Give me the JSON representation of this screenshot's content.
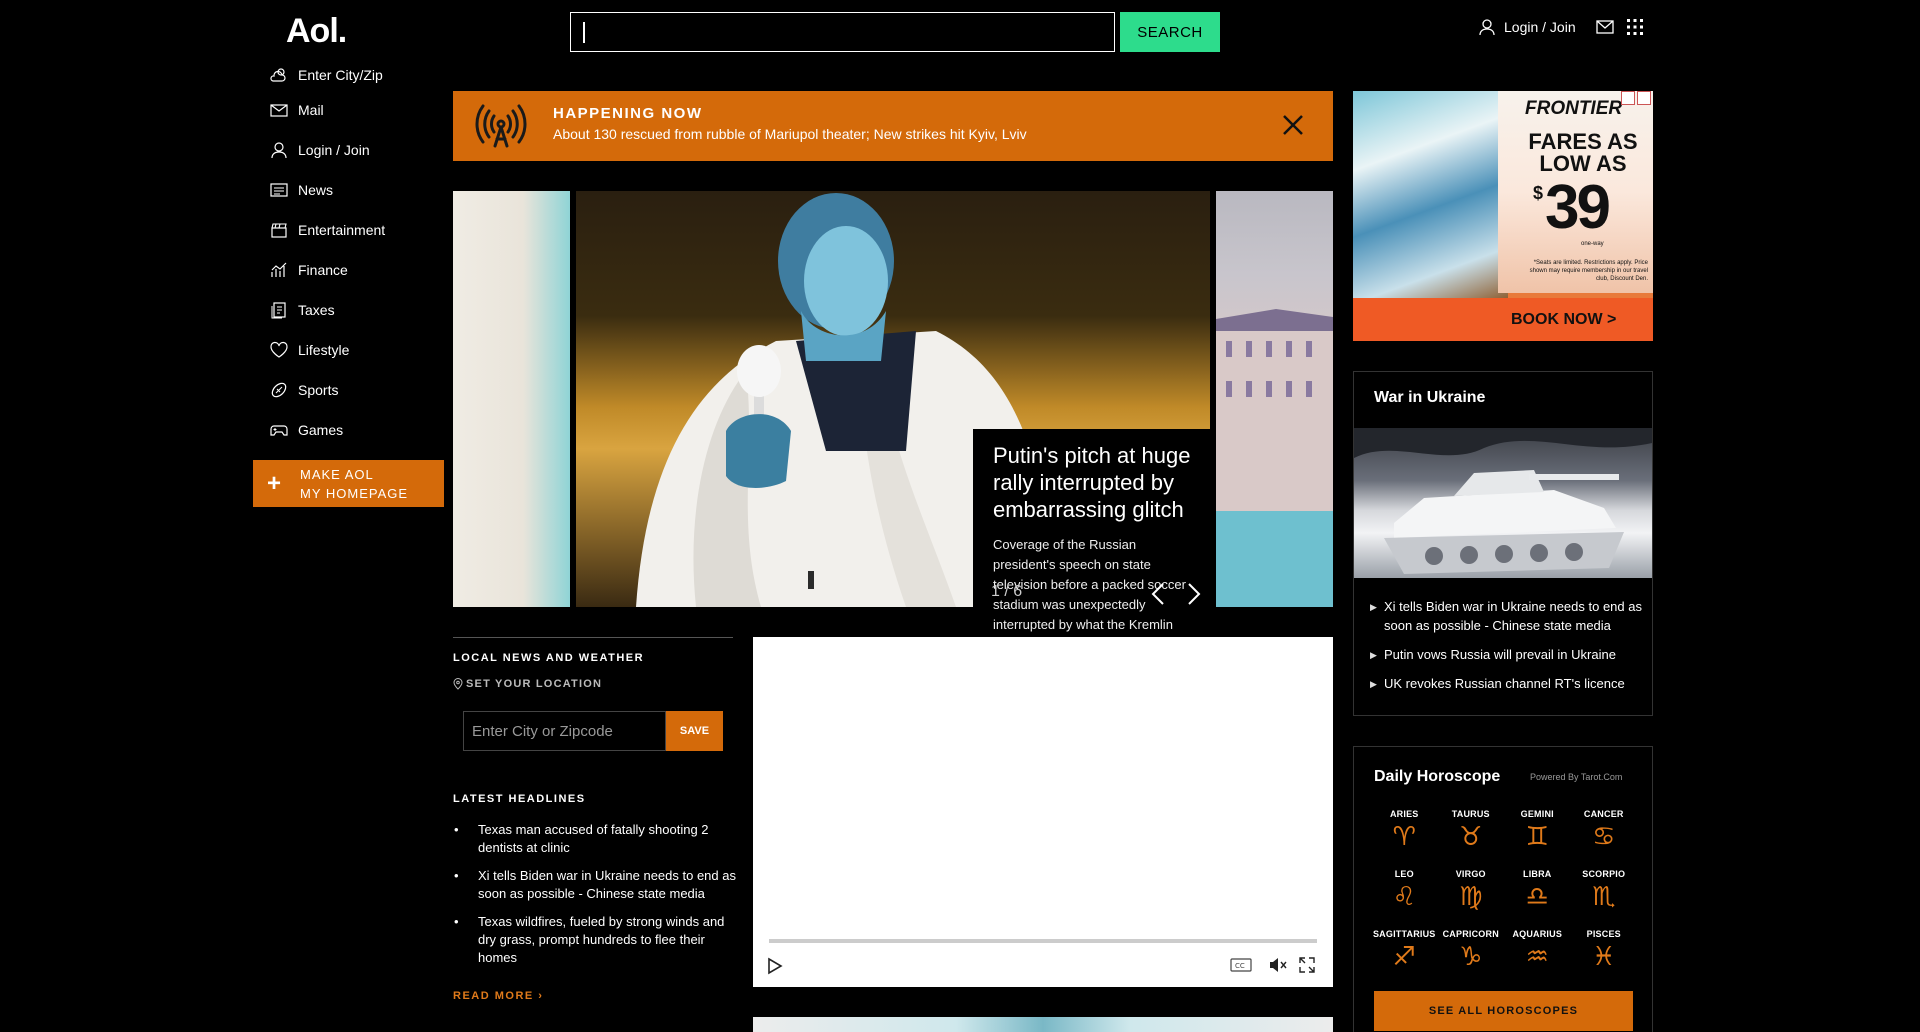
{
  "header": {
    "logo": "Aol.",
    "search_button": "SEARCH",
    "login": "Login / Join"
  },
  "sidebar": {
    "items": [
      {
        "label": "Enter City/Zip",
        "icon": "weather-icon"
      },
      {
        "label": "Mail",
        "icon": "mail-icon"
      },
      {
        "label": "Login / Join",
        "icon": "user-icon"
      },
      {
        "label": "News",
        "icon": "news-icon"
      },
      {
        "label": "Entertainment",
        "icon": "clapper-icon"
      },
      {
        "label": "Finance",
        "icon": "finance-icon"
      },
      {
        "label": "Taxes",
        "icon": "taxes-icon"
      },
      {
        "label": "Lifestyle",
        "icon": "heart-icon"
      },
      {
        "label": "Sports",
        "icon": "football-icon"
      },
      {
        "label": "Games",
        "icon": "gamepad-icon"
      }
    ],
    "make_homepage_line1": "MAKE AOL",
    "make_homepage_line2": "MY HOMEPAGE"
  },
  "happening": {
    "title": "HAPPENING NOW",
    "text": "About 130 rescued from rubble of Mariupol theater; New strikes hit Kyiv, Lviv"
  },
  "carousel": {
    "title": "Putin's pitch at huge rally interrupted by embarrassing glitch",
    "description": "Coverage of the Russian president's speech on state television before a packed soccer stadium was unexpectedly interrupted by what the Kremlin",
    "counter": "1 / 6"
  },
  "local": {
    "heading": "LOCAL NEWS AND WEATHER",
    "set_location": "SET YOUR LOCATION",
    "zip_placeholder": "Enter City or Zipcode",
    "save": "SAVE"
  },
  "latest": {
    "heading": "LATEST HEADLINES",
    "items": [
      "Texas man accused of fatally shooting 2 dentists at clinic",
      "Xi tells Biden war in Ukraine needs to end as soon as possible - Chinese state media",
      "Texas wildfires, fueled by strong winds and dry grass, prompt hundreds to flee their homes"
    ],
    "read_more": "READ MORE ›"
  },
  "ad": {
    "brand": "FRONTIER",
    "headline": "FARES AS LOW AS",
    "dollar": "$",
    "price": "39",
    "oneway": "one-way",
    "fine_print": "*Seats are limited. Restrictions apply. Price shown may require membership in our travel club, Discount Den.",
    "cta": "BOOK NOW >"
  },
  "war": {
    "title": "War in Ukraine",
    "items": [
      "Xi tells Biden war in Ukraine needs to end as soon as possible - Chinese state media",
      "Putin vows Russia will prevail in Ukraine",
      "UK revokes Russian channel RT's licence"
    ]
  },
  "horoscope": {
    "title": "Daily Horoscope",
    "powered": "Powered By Tarot.Com",
    "signs": [
      {
        "name": "ARIES",
        "glyph": "♈"
      },
      {
        "name": "TAURUS",
        "glyph": "♉"
      },
      {
        "name": "GEMINI",
        "glyph": "♊"
      },
      {
        "name": "CANCER",
        "glyph": "♋"
      },
      {
        "name": "LEO",
        "glyph": "♌"
      },
      {
        "name": "VIRGO",
        "glyph": "♍"
      },
      {
        "name": "LIBRA",
        "glyph": "♎"
      },
      {
        "name": "SCORPIO",
        "glyph": "♏"
      },
      {
        "name": "SAGITTARIUS",
        "glyph": "♐"
      },
      {
        "name": "CAPRICORN",
        "glyph": "♑"
      },
      {
        "name": "AQUARIUS",
        "glyph": "♒"
      },
      {
        "name": "PISCES",
        "glyph": "♓"
      }
    ],
    "see_all": "SEE ALL HOROSCOPES"
  },
  "colors": {
    "accent_orange": "#d46a0a",
    "search_green": "#2ddc8c",
    "background": "#000000"
  }
}
